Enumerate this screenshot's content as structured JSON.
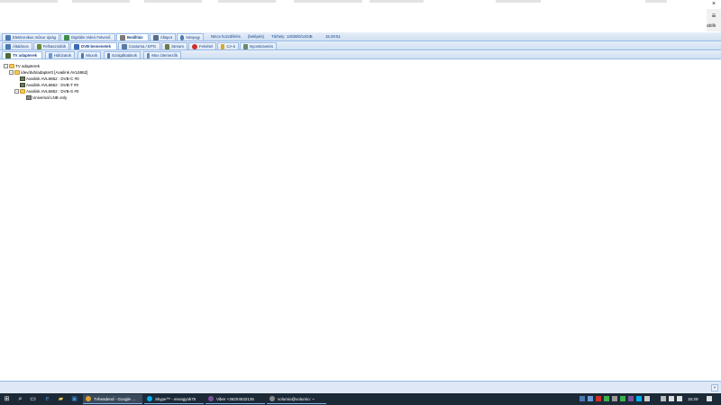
{
  "browser": {
    "close_glyph": "×",
    "menu_glyph": "≡",
    "menu_partial_text": "ablik"
  },
  "row1": {
    "tabs": [
      {
        "label": "Elektronikus műsor újság",
        "icon": "epg-icon",
        "color": "#4a7ab5"
      },
      {
        "label": "Digitális Videó Felvevő",
        "icon": "dvr-icon",
        "color": "#3b8f4a"
      },
      {
        "label": "Beállítás",
        "icon": "wrench-icon",
        "color": "#7a7a7a",
        "active": true
      },
      {
        "label": "Állapot",
        "icon": "status-icon",
        "color": "#5a6a8a"
      },
      {
        "label": "Névjegy",
        "icon": "about-icon",
        "color": "#4a7ab5"
      }
    ],
    "info": {
      "guest": "Nincs hozzáférés",
      "login": "(belépés)",
      "storage_label": "Tárhely:",
      "storage_value": "13GiB/0/13GiB",
      "time": "15:29:51"
    }
  },
  "row2": {
    "tabs": [
      {
        "label": "Általános",
        "icon": "general-icon",
        "color": "#4a7ab5"
      },
      {
        "label": "Felhasználók",
        "icon": "users-icon",
        "color": "#6a8a3a"
      },
      {
        "label": "DVB-bemenetek",
        "icon": "dvb-icon",
        "color": "#3a6ab5",
        "active": true
      },
      {
        "label": "Csatorna / EPG",
        "icon": "channel-icon",
        "color": "#5a7aa5"
      },
      {
        "label": "Stream",
        "icon": "stream-icon",
        "color": "#6a7a4a"
      },
      {
        "label": "Felvétel",
        "icon": "record-icon",
        "color": "#d0302a"
      },
      {
        "label": "CA-k",
        "icon": "key-icon",
        "color": "#d6a830"
      },
      {
        "label": "Nyomkövetés",
        "icon": "debug-icon",
        "color": "#6a8a6a"
      }
    ]
  },
  "row3": {
    "tabs": [
      {
        "label": "TV adapterek",
        "icon": "tv-adapter-icon",
        "color": "#4a6a3a",
        "active": true
      },
      {
        "label": "Hálózatok",
        "icon": "network-icon",
        "color": "#6a9ad5"
      },
      {
        "label": "Muxok",
        "icon": "mux-icon",
        "color": "#4a7ab5"
      },
      {
        "label": "Szolgáltatások",
        "icon": "services-icon",
        "color": "#5a7aa5"
      },
      {
        "label": "Mux Ütemezők",
        "icon": "scheduler-icon",
        "color": "#6a8ab5"
      }
    ]
  },
  "tree": {
    "root": "TV adapterek",
    "device": "/dev/dvb/adapter0 [Availink AVL6862]",
    "frontends": [
      "Availink AVL6862 : DVB-C #0",
      "Availink AVL6862 : DVB-T #0",
      "Availink AVL6862 : DVB-S #0"
    ],
    "lnb": "Universal LNB only"
  },
  "bottom": {
    "button_glyph": "«"
  },
  "taskbar": {
    "apps": [
      {
        "label": "Tvheadend - Google ...",
        "color": "#e0a030",
        "active": true
      },
      {
        "label": "Skype™ - envagyok75",
        "color": "#00aff0"
      },
      {
        "label": "Viber +36204532135",
        "color": "#7b519d"
      },
      {
        "label": "volumio@volumio: ~",
        "color": "#888888"
      }
    ],
    "clock": "15:29"
  }
}
